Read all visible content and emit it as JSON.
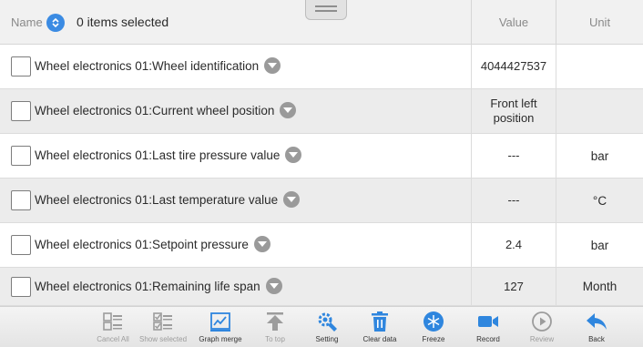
{
  "header": {
    "name_label": "Name",
    "selected_count": "0 items selected",
    "value_label": "Value",
    "unit_label": "Unit"
  },
  "rows": [
    {
      "label": "Wheel electronics 01:Wheel identification",
      "value": "4044427537",
      "unit": ""
    },
    {
      "label": "Wheel electronics 01:Current wheel position",
      "value": "Front left position",
      "unit": ""
    },
    {
      "label": "Wheel electronics 01:Last tire pressure value",
      "value": "---",
      "unit": "bar"
    },
    {
      "label": "Wheel electronics 01:Last temperature value",
      "value": "---",
      "unit": "°C"
    },
    {
      "label": "Wheel electronics 01:Setpoint pressure",
      "value": "2.4",
      "unit": "bar"
    },
    {
      "label": "Wheel electronics 01:Remaining life span",
      "value": "127",
      "unit": "Month"
    }
  ],
  "toolbar": [
    {
      "id": "cancel-all",
      "label": "Cancel All",
      "icon": "grid-list-icon",
      "enabled": false
    },
    {
      "id": "show-selected",
      "label": "Show selected",
      "icon": "checklist-icon",
      "enabled": false
    },
    {
      "id": "graph-merge",
      "label": "Graph merge",
      "icon": "line-chart-icon",
      "enabled": true
    },
    {
      "id": "to-top",
      "label": "To top",
      "icon": "arrow-up-bar-icon",
      "enabled": false
    },
    {
      "id": "setting",
      "label": "Setting",
      "icon": "gear-wrench-icon",
      "enabled": true
    },
    {
      "id": "clear-data",
      "label": "Clear data",
      "icon": "trash-icon",
      "enabled": true
    },
    {
      "id": "freeze",
      "label": "Freeze",
      "icon": "snowflake-icon",
      "enabled": true
    },
    {
      "id": "record",
      "label": "Record",
      "icon": "video-camera-icon",
      "enabled": true
    },
    {
      "id": "review",
      "label": "Review",
      "icon": "play-circle-icon",
      "enabled": false
    },
    {
      "id": "back",
      "label": "Back",
      "icon": "back-arrow-icon",
      "enabled": true
    }
  ],
  "colors": {
    "accent_blue": "#2f86de",
    "disabled_gray": "#9c9c9c",
    "row_alt": "#ececec"
  }
}
